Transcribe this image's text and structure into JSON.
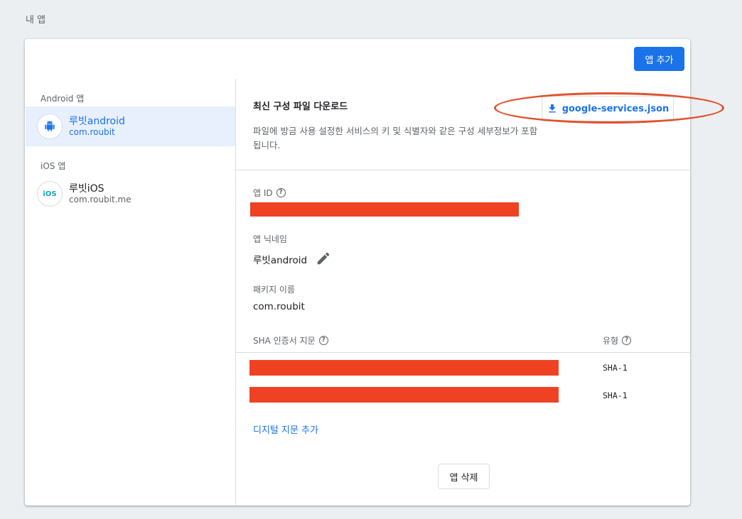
{
  "page_title": "내 앱",
  "add_app_button": "앱 추가",
  "sidebar": {
    "android_group_label": "Android 앱",
    "ios_group_label": "iOS 앱",
    "android_app": {
      "name": "루빗android",
      "package": "com.roubit",
      "icon": "android-icon"
    },
    "ios_app": {
      "name": "루빗iOS",
      "bundle": "com.roubit.me",
      "icon_text": "iOS"
    }
  },
  "config": {
    "title": "최신 구성 파일 다운로드",
    "description": "파일에 방금 사용 설정한 서비스의 키 및 식별자와 같은 구성 세부정보가 포함됩니다.",
    "download_button": "google-services.json",
    "download_icon": "download-icon"
  },
  "fields": {
    "app_id_label": "앱 ID",
    "nickname_label": "앱 닉네임",
    "nickname_value": "루빗android",
    "package_label": "패키지 이름",
    "package_value": "com.roubit",
    "sha_label": "SHA 인증서 지문",
    "type_label": "유형",
    "sha_rows": [
      {
        "type": "SHA-1"
      },
      {
        "type": "SHA-1"
      }
    ],
    "help_symbol": "?"
  },
  "add_fingerprint_link": "디지털 지문 추가",
  "delete_button": "앱 삭제",
  "colors": {
    "accent": "#1a73e8",
    "redaction": "#ef4223",
    "annotation": "#e0522f"
  }
}
